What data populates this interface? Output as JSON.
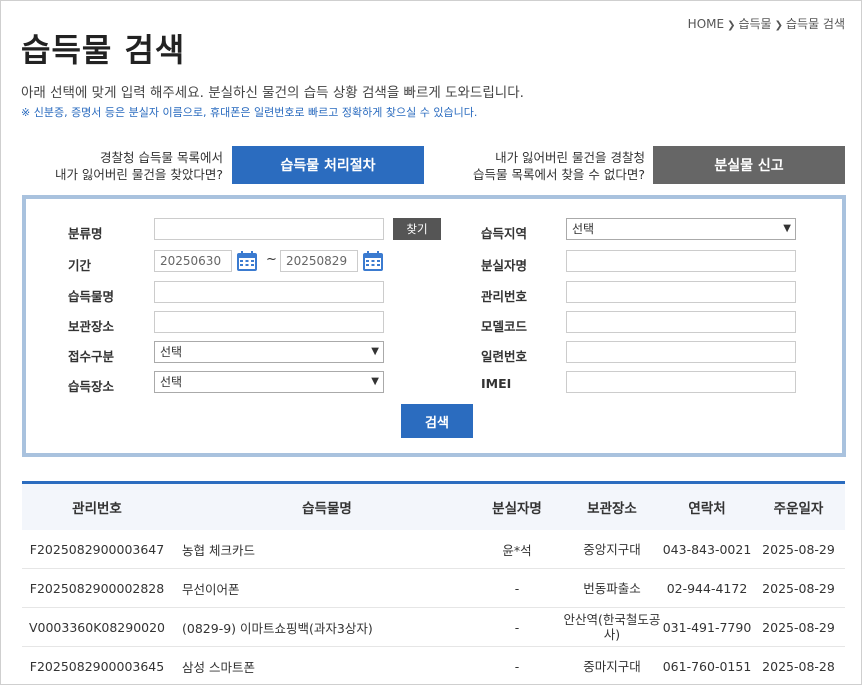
{
  "breadcrumb": [
    "HOME",
    "습득물",
    "습득물 검색"
  ],
  "title": "습득물 검색",
  "description": "아래 선택에 맞게 입력 해주세요. 분실하신 물건의 습득 상황 검색을 빠르게 도와드립니다.",
  "note": "※ 신분증, 증명서 등은 분실자 이름으로, 휴대폰은 일련번호로 빠르고 정확하게 찾으실 수 있습니다.",
  "cta_left": {
    "line1": "경찰청 습득물 목록에서",
    "line2": "내가 잃어버린 물건을 찾았다면?",
    "button": "습득물 처리절차"
  },
  "cta_right": {
    "line1": "내가 잃어버린 물건을 경찰청",
    "line2": "습득물 목록에서 찾을 수 없다면?",
    "button": "분실물 신고"
  },
  "form": {
    "category_label": "분류명",
    "category_value": "",
    "find_button": "찾기",
    "period_label": "기간",
    "date_from": "20250630",
    "date_to": "20250829",
    "tilde": "~",
    "item_name_label": "습득물명",
    "storage_label": "보관장소",
    "receipt_type_label": "접수구분",
    "receipt_type_value": "선택",
    "found_place_label": "습득장소",
    "found_place_value": "선택",
    "region_label": "습득지역",
    "region_value": "선택",
    "owner_label": "분실자명",
    "manage_no_label": "관리번호",
    "model_code_label": "모델코드",
    "serial_label": "일련번호",
    "imei_label": "IMEI",
    "search_button": "검색"
  },
  "table": {
    "headers": [
      "관리번호",
      "습득물명",
      "분실자명",
      "보관장소",
      "연락처",
      "주운일자"
    ],
    "rows": [
      [
        "F2025082900003647",
        "농협 체크카드",
        "윤*석",
        "중앙지구대",
        "043-843-0021",
        "2025-08-29"
      ],
      [
        "F2025082900002828",
        "무선이어폰",
        "-",
        "번동파출소",
        "02-944-4172",
        "2025-08-29"
      ],
      [
        "V0003360K08290020",
        "(0829-9) 이마트쇼핑백(과자3상자)",
        "-",
        "안산역(한국철도공사)",
        "031-491-7790",
        "2025-08-29"
      ],
      [
        "F2025082900003645",
        "삼성 스마트폰",
        "-",
        "중마지구대",
        "061-760-0151",
        "2025-08-28"
      ]
    ]
  }
}
